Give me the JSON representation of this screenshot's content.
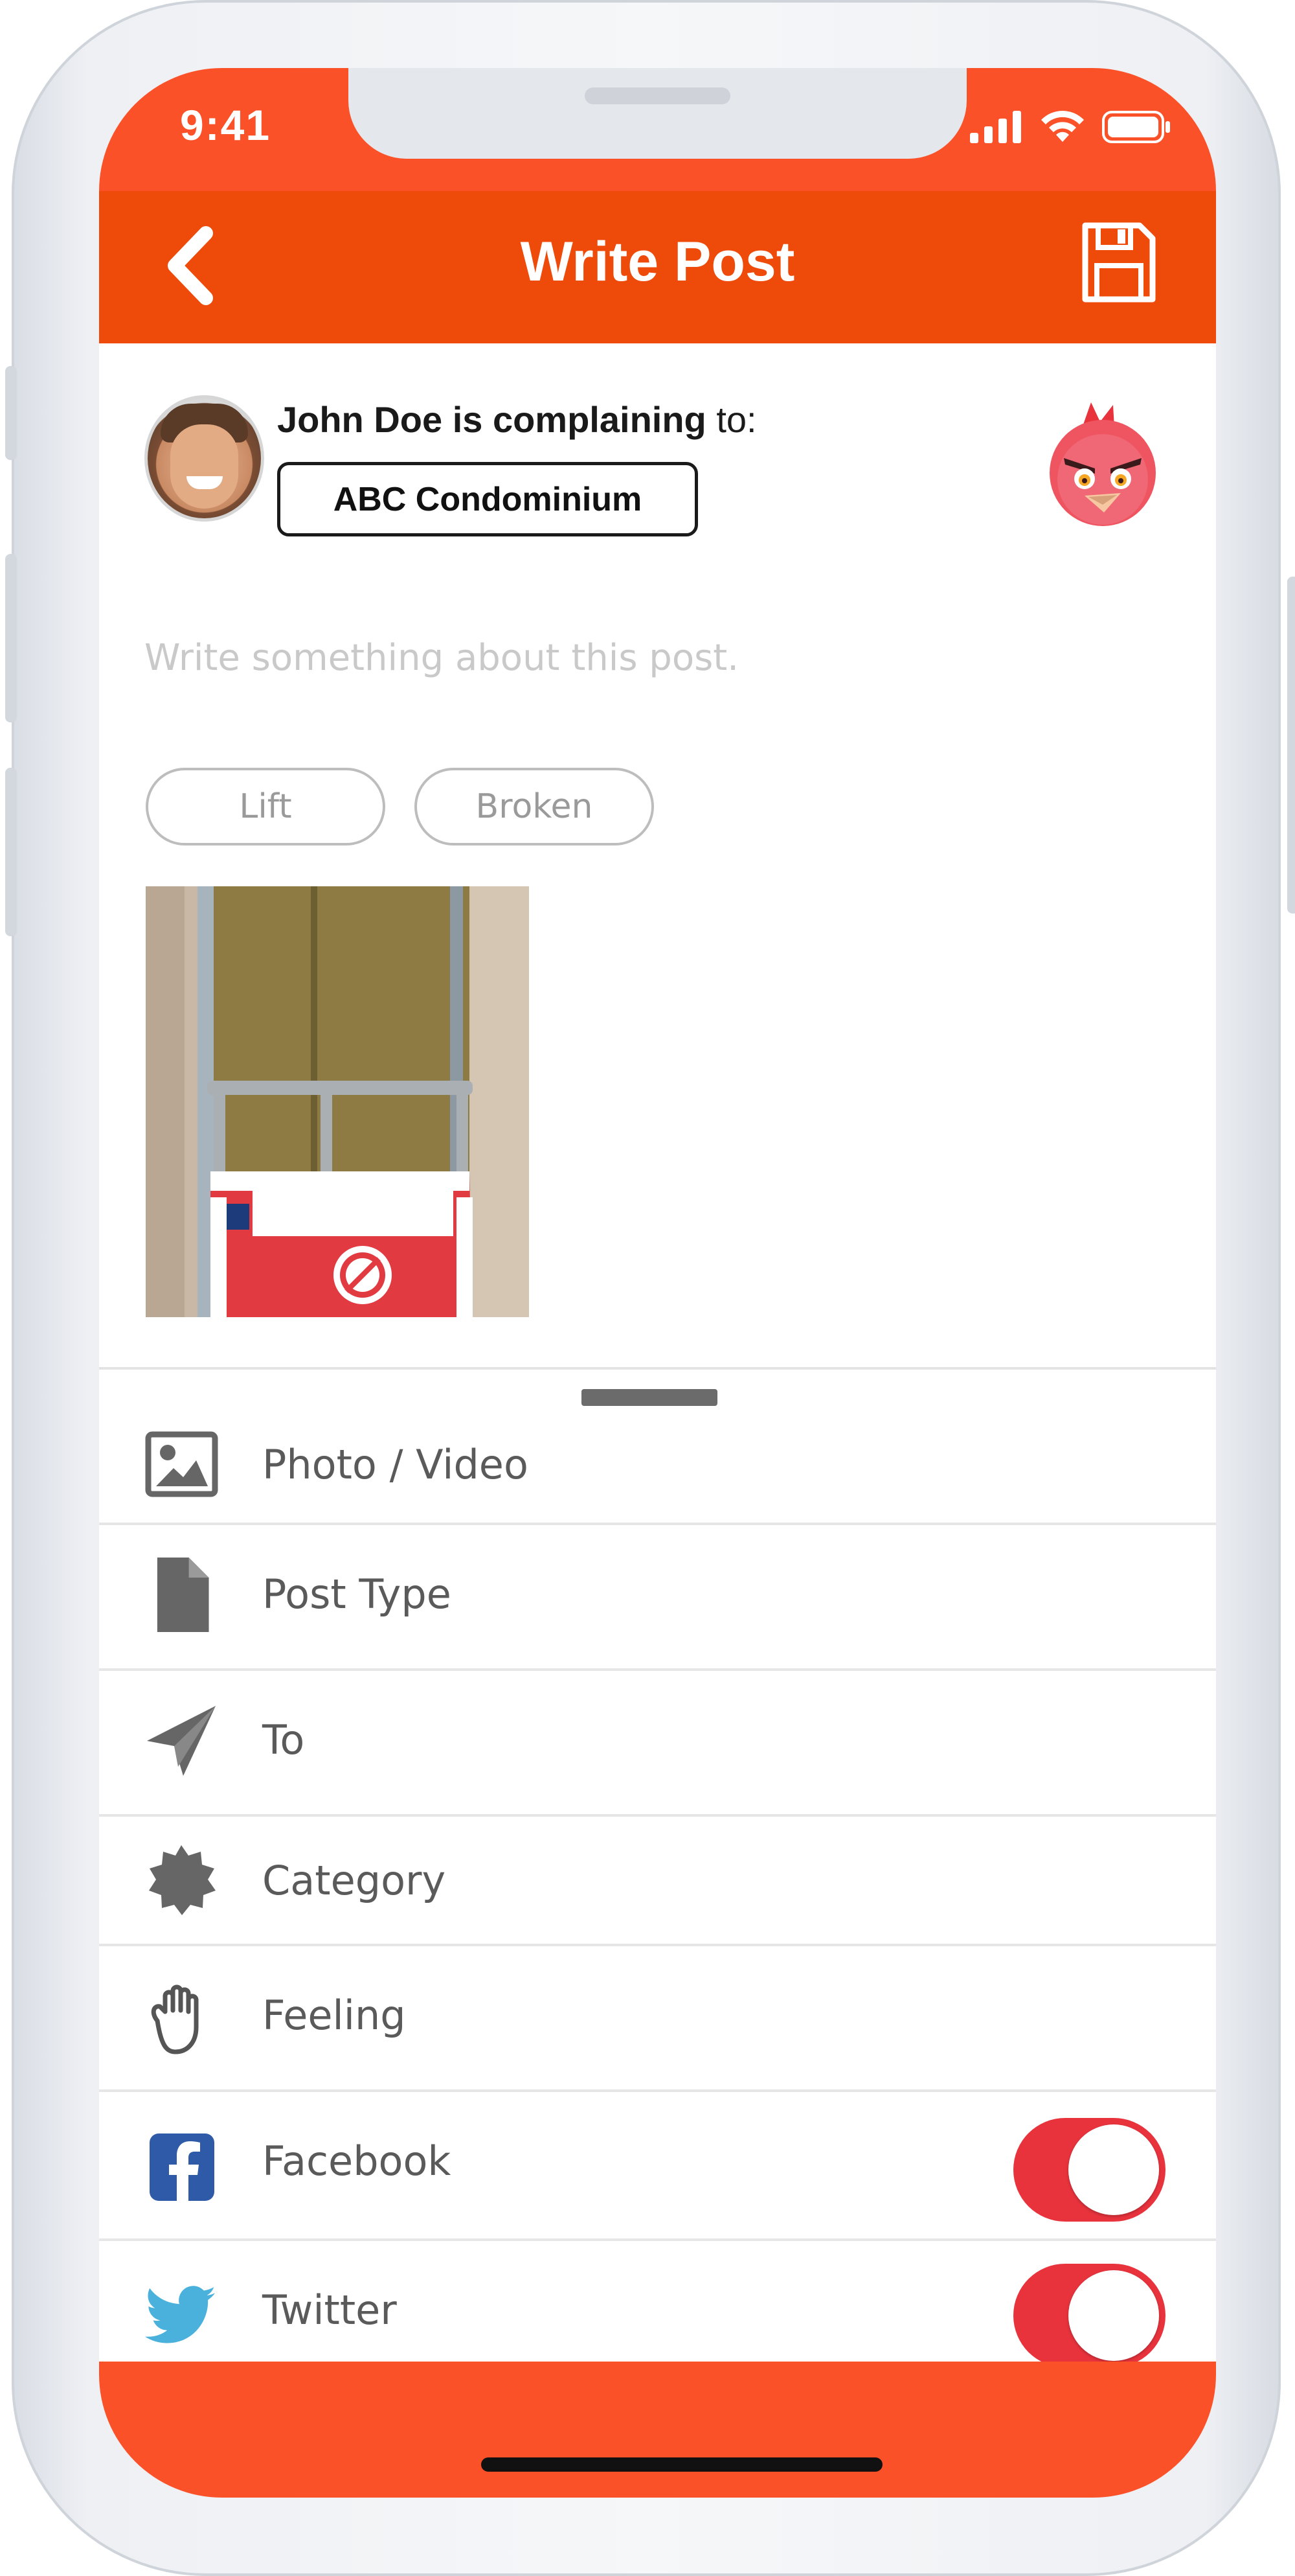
{
  "status_bar": {
    "time": "9:41"
  },
  "header": {
    "title": "Write Post"
  },
  "post": {
    "author": "John Doe",
    "verb": "is complaining",
    "preposition": "to:",
    "recipient": "ABC Condominium",
    "placeholder": "Write something about this post.",
    "tags": [
      "Lift",
      "Broken"
    ]
  },
  "options": [
    {
      "label": "Photo / Video",
      "icon": "image-icon"
    },
    {
      "label": "Post Type",
      "icon": "document-icon"
    },
    {
      "label": "To",
      "icon": "paper-plane-icon"
    },
    {
      "label": "Category",
      "icon": "badge-icon"
    },
    {
      "label": "Feeling",
      "icon": "hand-icon"
    },
    {
      "label": "Facebook",
      "icon": "facebook-icon",
      "toggle_on": true
    },
    {
      "label": "Twitter",
      "icon": "twitter-icon",
      "toggle_on": true
    }
  ],
  "colors": {
    "accent": "#ee4a09",
    "status_bar": "#fb5129",
    "toggle_on": "#e8333d",
    "facebook": "#2f5aa8",
    "twitter": "#4ab0dc"
  }
}
